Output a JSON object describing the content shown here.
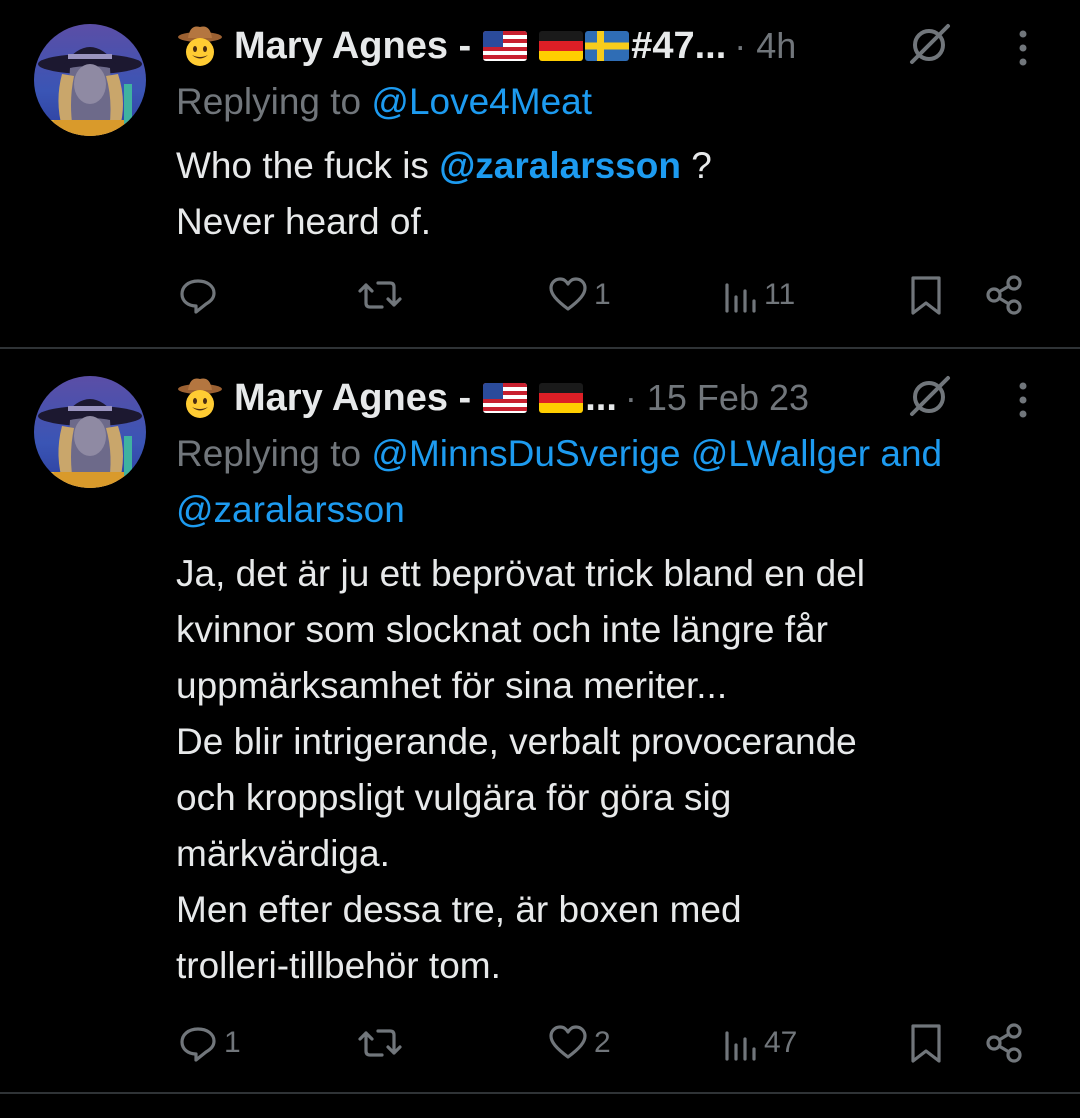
{
  "tweets": [
    {
      "author": "Mary Agnes - ",
      "name_trail": "#47...",
      "time": "· 4h",
      "reply_prefix": "Replying to ",
      "reply_to": [
        "@Love4Meat"
      ],
      "body_before": "Who the fuck is ",
      "body_mention": "@zaralarsson",
      "body_after": " ?",
      "body_line2": "Never heard of.",
      "replies": "",
      "reposts": "",
      "likes": "1",
      "views": "11"
    },
    {
      "author": "Mary Agnes - ",
      "name_trail": "...",
      "time": "· 15 Feb 23",
      "reply_prefix": "Replying to ",
      "reply_to": [
        "@MinnsDuSverige",
        "@LWallger",
        "@zaralarsson"
      ],
      "reply_and": " and",
      "body_lines": [
        "Ja, det är ju ett beprövat trick bland en del",
        "kvinnor som slocknat och inte längre får",
        "uppmärksamhet för sina meriter...",
        "De blir intrigerande, verbalt provocerande",
        "och kroppsligt vulgära för göra sig",
        "märkvärdiga.",
        "Men efter dessa tre, är boxen med",
        "trolleri-tillbehör tom."
      ],
      "replies": "1",
      "reposts": "",
      "likes": "2",
      "views": "47"
    }
  ],
  "icons": {
    "emoji": "cowboy-hat-face-icon",
    "flags": [
      "us-flag-icon",
      "germany-flag-icon",
      "sweden-flag-icon"
    ],
    "grok": "grok-icon",
    "more": "more-icon",
    "actions": [
      "reply-icon",
      "repost-icon",
      "like-icon",
      "views-icon",
      "bookmark-icon",
      "share-icon"
    ]
  },
  "colors": {
    "background": "#000000",
    "text": "#e7e9ea",
    "muted": "#71767b",
    "link": "#1d9bf0",
    "divider": "#2f3336"
  }
}
